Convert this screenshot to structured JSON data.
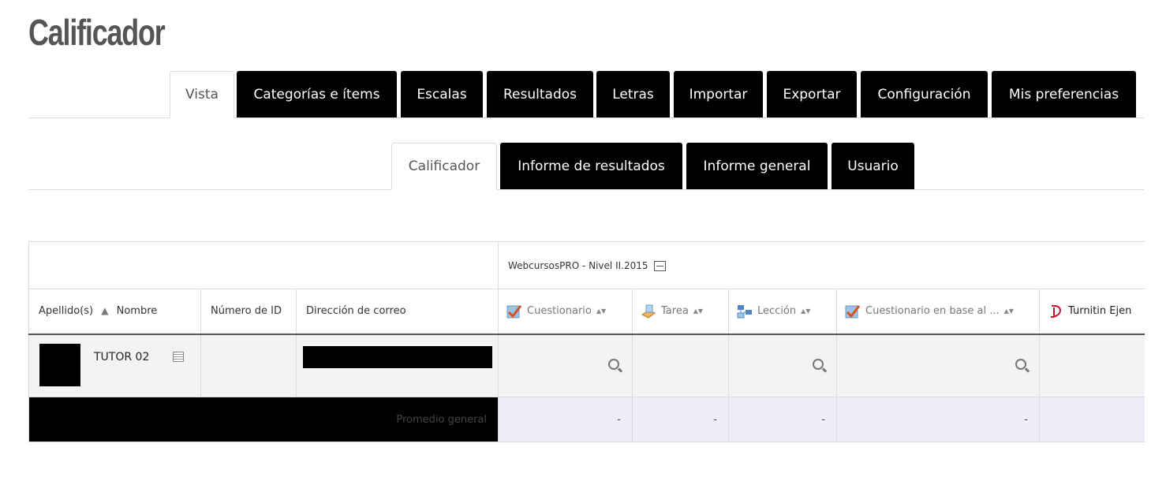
{
  "page": {
    "title": "Calificador"
  },
  "primary_tabs": [
    {
      "label": "Vista",
      "active": true
    },
    {
      "label": "Categorías e ítems",
      "active": false
    },
    {
      "label": "Escalas",
      "active": false
    },
    {
      "label": "Resultados",
      "active": false
    },
    {
      "label": "Letras",
      "active": false
    },
    {
      "label": "Importar",
      "active": false
    },
    {
      "label": "Exportar",
      "active": false
    },
    {
      "label": "Configuración",
      "active": false
    },
    {
      "label": "Mis preferencias",
      "active": false
    }
  ],
  "secondary_tabs": [
    {
      "label": "Calificador",
      "active": true
    },
    {
      "label": "Informe de resultados",
      "active": false
    },
    {
      "label": "Informe general",
      "active": false
    },
    {
      "label": "Usuario",
      "active": false
    }
  ],
  "grade_table": {
    "category_name": "WebcursosPRO - Nivel II.2015",
    "columns": {
      "lastname": "Apellido(s)",
      "firstname": "Nombre",
      "idnumber": "Número de ID",
      "email": "Dirección de correo"
    },
    "items": [
      {
        "name": "Cuestionario",
        "icon": "quiz-icon"
      },
      {
        "name": "Tarea",
        "icon": "assignment-icon"
      },
      {
        "name": "Lección",
        "icon": "lesson-icon"
      },
      {
        "name": "Cuestionario en base al ...",
        "icon": "quiz-icon"
      },
      {
        "name": "Turnitin Ejen",
        "icon": "turnitin-icon"
      }
    ],
    "rows": [
      {
        "name": "TUTOR 02",
        "grades": [
          "",
          "",
          "",
          "",
          ""
        ]
      }
    ],
    "overall_average": {
      "label": "Promedio general",
      "values": [
        "-",
        "-",
        "-",
        "-",
        ""
      ]
    }
  },
  "colors": {
    "tab_bg": "#000000",
    "avg_row_bg": "#eeeefb",
    "title": "#555555"
  }
}
